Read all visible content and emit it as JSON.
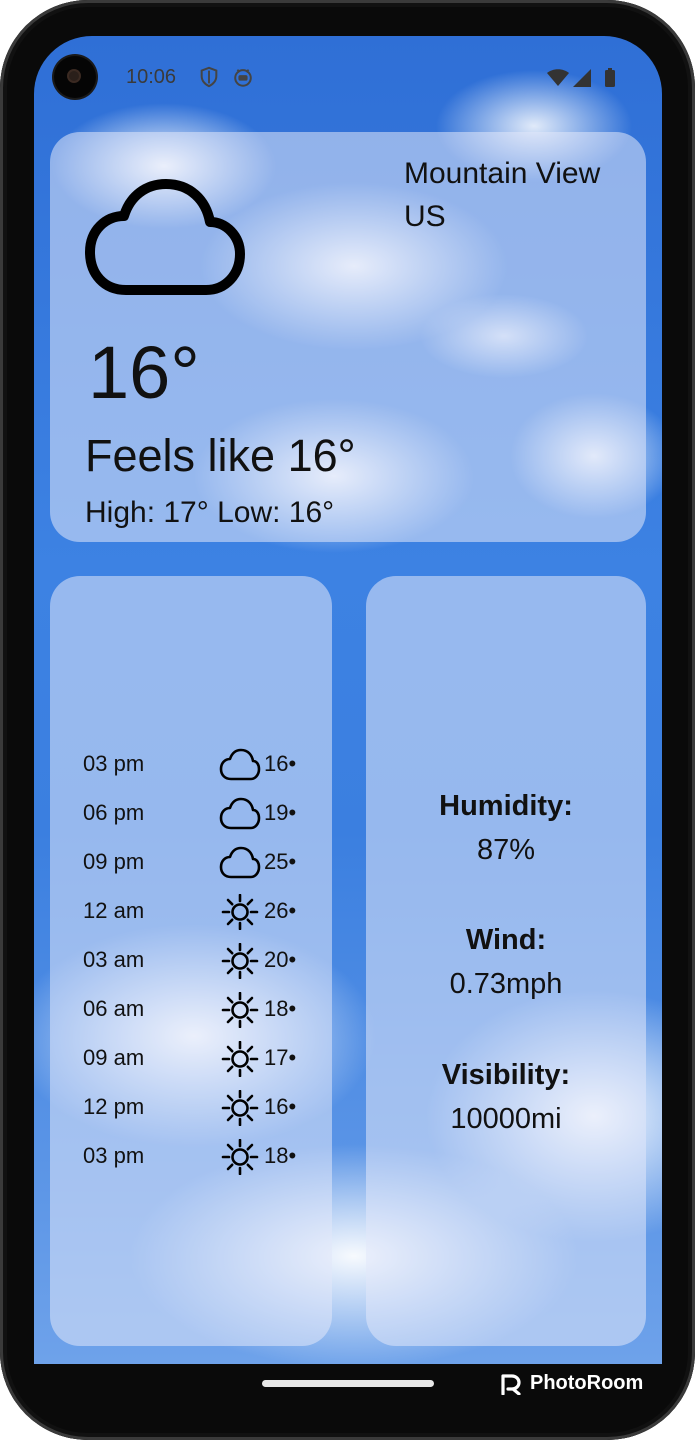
{
  "status_bar": {
    "time": "10:06"
  },
  "location": {
    "city": "Mountain View",
    "country": "US"
  },
  "current": {
    "temperature": "16°",
    "feels_like": "Feels like 16°",
    "high_low": "High: 17° Low: 16°",
    "icon": "cloud-icon"
  },
  "forecast": [
    {
      "time": "03 pm",
      "icon": "cloud",
      "temp": "16•"
    },
    {
      "time": "06 pm",
      "icon": "cloud",
      "temp": "19•"
    },
    {
      "time": "09 pm",
      "icon": "cloud",
      "temp": "25•"
    },
    {
      "time": "12 am",
      "icon": "sun",
      "temp": "26•"
    },
    {
      "time": "03 am",
      "icon": "sun",
      "temp": "20•"
    },
    {
      "time": "06 am",
      "icon": "sun",
      "temp": "18•"
    },
    {
      "time": "09 am",
      "icon": "sun",
      "temp": "17•"
    },
    {
      "time": "12 pm",
      "icon": "sun",
      "temp": "16•"
    },
    {
      "time": "03 pm",
      "icon": "sun",
      "temp": "18•"
    }
  ],
  "details": {
    "humidity_label": "Humidity:",
    "humidity_value": "87%",
    "wind_label": "Wind:",
    "wind_value": "0.73mph",
    "visibility_label": "Visibility:",
    "visibility_value": "10000mi"
  },
  "watermark": {
    "text": "PhotoRoom"
  },
  "colors": {
    "sky": "#3b7fe0",
    "card": "#e1e8fa",
    "text": "#111111"
  }
}
